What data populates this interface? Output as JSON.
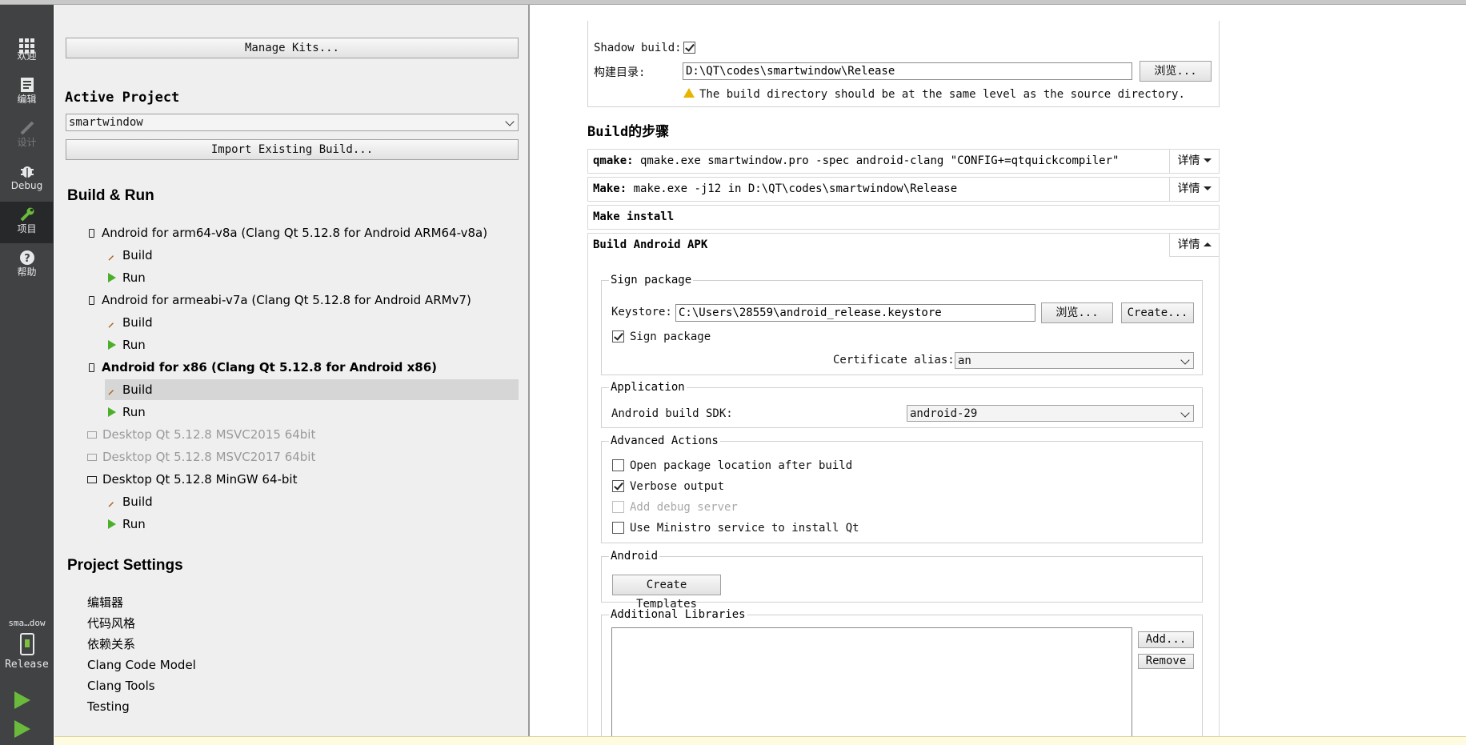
{
  "modebar": {
    "items": [
      {
        "label": "欢迎",
        "icon": "grid-icon"
      },
      {
        "label": "编辑",
        "icon": "document-icon"
      },
      {
        "label": "设计",
        "icon": "pencil-icon"
      },
      {
        "label": "Debug",
        "icon": "bug-icon"
      },
      {
        "label": "项目",
        "icon": "wrench-icon"
      },
      {
        "label": "帮助",
        "icon": "help-icon"
      }
    ],
    "kit_selector": {
      "project": "sma…dow",
      "config": "Release"
    }
  },
  "left": {
    "manage_kits": "Manage Kits...",
    "active_project_title": "Active Project",
    "active_project_value": "smartwindow",
    "import_build": "Import Existing Build...",
    "build_run_title": "Build & Run",
    "kits": [
      {
        "name": "Android for arm64-v8a (Clang Qt 5.12.8 for Android ARM64-v8a)",
        "build": "Build",
        "run": "Run"
      },
      {
        "name": "Android for armeabi-v7a (Clang Qt 5.12.8 for Android ARMv7)",
        "build": "Build",
        "run": "Run"
      },
      {
        "name": "Android for x86 (Clang Qt 5.12.8 for Android x86)",
        "build": "Build",
        "run": "Run"
      },
      {
        "name": "Desktop Qt 5.12.8 MSVC2015 64bit"
      },
      {
        "name": "Desktop Qt 5.12.8 MSVC2017 64bit"
      },
      {
        "name": "Desktop Qt 5.12.8 MinGW 64-bit",
        "build": "Build",
        "run": "Run"
      }
    ],
    "project_settings_title": "Project Settings",
    "settings": [
      "编辑器",
      "代码风格",
      "依赖关系",
      "Clang Code Model",
      "Clang Tools",
      "Testing"
    ]
  },
  "general": {
    "shadow_build_label": "Shadow build:",
    "build_dir_label": "构建目录:",
    "build_dir_value": "D:\\QT\\codes\\smartwindow\\Release",
    "browse": "浏览...",
    "warning": "The build directory should be at the same level as the source directory."
  },
  "build_steps": {
    "title": "Build的步骤",
    "details": "详情",
    "qmake_name": "qmake:",
    "qmake_cmd": " qmake.exe smartwindow.pro -spec android-clang \"CONFIG+=qtquickcompiler\"",
    "make_name": "Make:",
    "make_cmd": " make.exe -j12 in D:\\QT\\codes\\smartwindow\\Release",
    "make_install": "Make install",
    "apk_title": "Build Android APK"
  },
  "sign": {
    "group": "Sign package",
    "keystore_label": "Keystore:",
    "keystore_value": "C:\\Users\\28559\\android_release.keystore",
    "browse": "浏览...",
    "create": "Create...",
    "sign_checkbox": "Sign package",
    "alias_label": "Certificate alias:",
    "alias_value": "an"
  },
  "application": {
    "group": "Application",
    "sdk_label": "Android build SDK:",
    "sdk_value": "android-29"
  },
  "advanced": {
    "group": "Advanced Actions",
    "open_location": "Open package location after build",
    "verbose": "Verbose output",
    "debug_server": "Add debug server",
    "ministro": "Use Ministro service to install Qt"
  },
  "android": {
    "group": "Android",
    "create_templates": "Create Templates"
  },
  "libraries": {
    "group": "Additional Libraries",
    "add": "Add...",
    "remove": "Remove"
  }
}
